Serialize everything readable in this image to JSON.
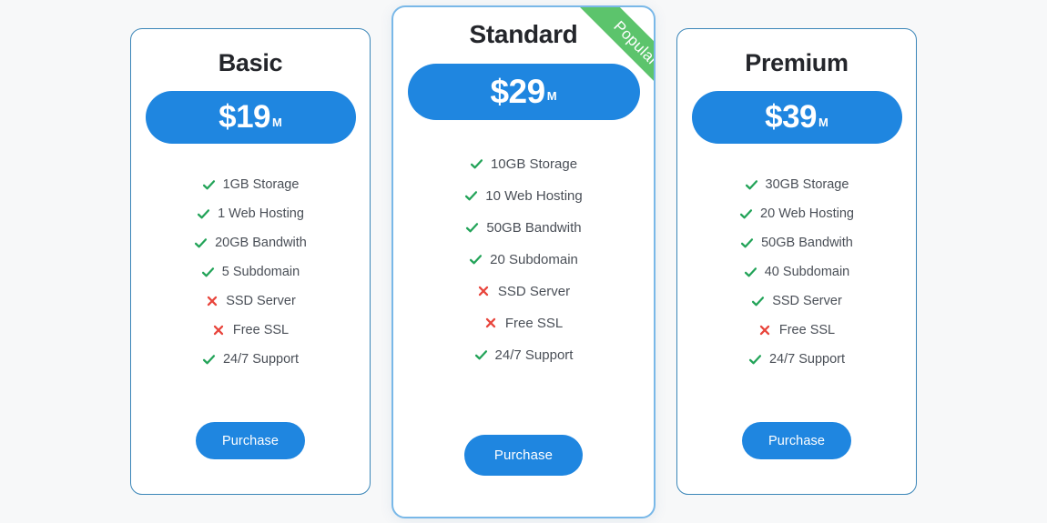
{
  "theme": {
    "page_background": "#f7f8f9",
    "accent_blue": "#1f86e0",
    "check_green": "#22a358",
    "cross_red": "#e8453c",
    "ribbon_green": "#5cc46c",
    "card_border": "#3b86b8"
  },
  "plans": [
    {
      "name": "Basic",
      "currency_symbol": "$",
      "price": "19",
      "price_display": "$19",
      "period": "M",
      "featured": false,
      "badge": null,
      "cta_label": "Purchase",
      "features": [
        {
          "label": "1GB Storage",
          "included": true
        },
        {
          "label": "1 Web Hosting",
          "included": true
        },
        {
          "label": "20GB Bandwith",
          "included": true
        },
        {
          "label": "5 Subdomain",
          "included": true
        },
        {
          "label": "SSD Server",
          "included": false
        },
        {
          "label": "Free SSL",
          "included": false
        },
        {
          "label": "24/7 Support",
          "included": true
        }
      ]
    },
    {
      "name": "Standard",
      "currency_symbol": "$",
      "price": "29",
      "price_display": "$29",
      "period": "M",
      "featured": true,
      "badge": "Popular",
      "cta_label": "Purchase",
      "features": [
        {
          "label": "10GB Storage",
          "included": true
        },
        {
          "label": "10 Web Hosting",
          "included": true
        },
        {
          "label": "50GB Bandwith",
          "included": true
        },
        {
          "label": "20 Subdomain",
          "included": true
        },
        {
          "label": "SSD Server",
          "included": false
        },
        {
          "label": "Free SSL",
          "included": false
        },
        {
          "label": "24/7 Support",
          "included": true
        }
      ]
    },
    {
      "name": "Premium",
      "currency_symbol": "$",
      "price": "39",
      "price_display": "$39",
      "period": "M",
      "featured": false,
      "badge": null,
      "cta_label": "Purchase",
      "features": [
        {
          "label": "30GB Storage",
          "included": true
        },
        {
          "label": "20 Web Hosting",
          "included": true
        },
        {
          "label": "50GB Bandwith",
          "included": true
        },
        {
          "label": "40 Subdomain",
          "included": true
        },
        {
          "label": "SSD Server",
          "included": true
        },
        {
          "label": "Free SSL",
          "included": false
        },
        {
          "label": "24/7 Support",
          "included": true
        }
      ]
    }
  ]
}
